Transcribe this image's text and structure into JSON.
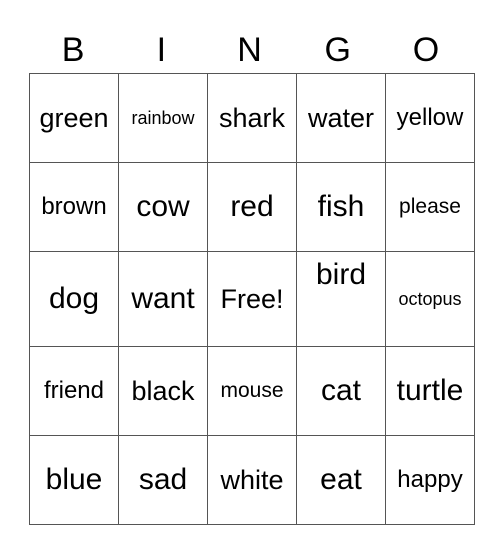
{
  "header": [
    "B",
    "I",
    "N",
    "G",
    "O"
  ],
  "rows": [
    [
      "green",
      "rainbow",
      "shark",
      "water",
      "yellow"
    ],
    [
      "brown",
      "cow",
      "red",
      "fish",
      "please"
    ],
    [
      "dog",
      "want",
      "Free!",
      "bird",
      "octopus"
    ],
    [
      "friend",
      "black",
      "mouse",
      "cat",
      "turtle"
    ],
    [
      "blue",
      "sad",
      "white",
      "eat",
      "happy"
    ]
  ]
}
